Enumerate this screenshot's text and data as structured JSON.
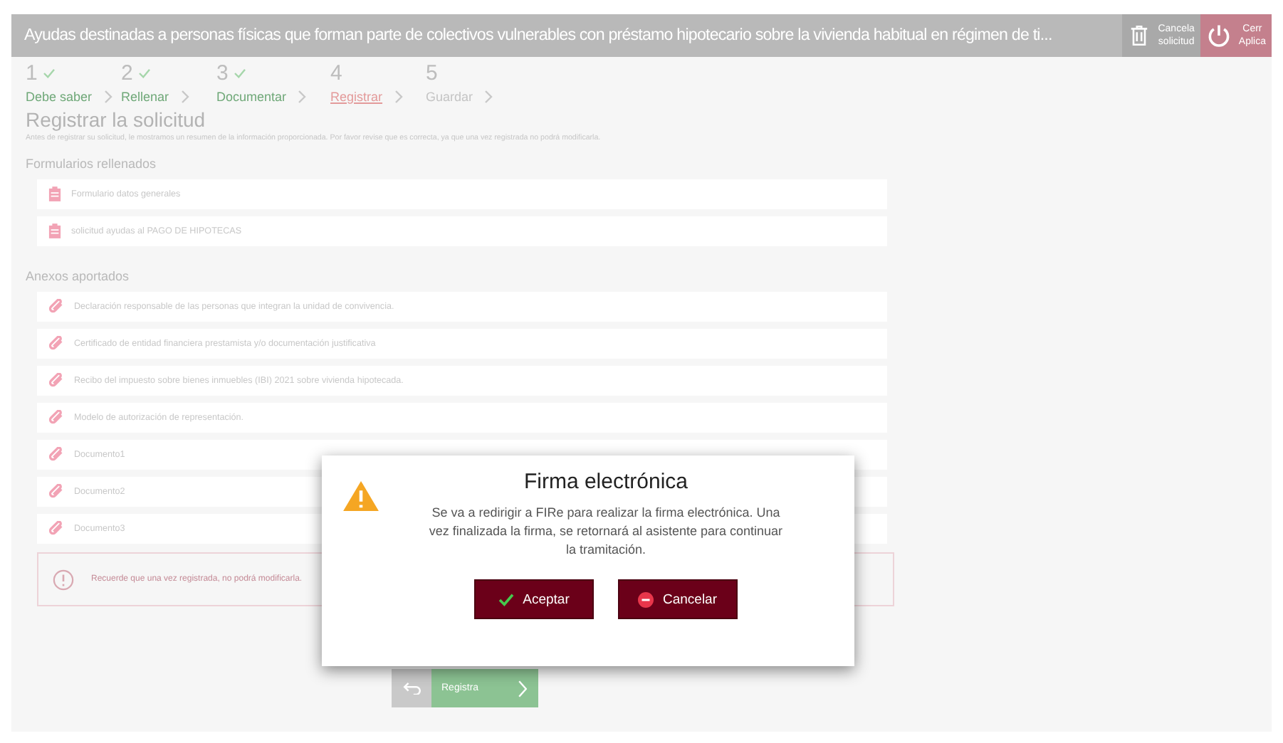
{
  "header": {
    "title": "Ayudas destinadas a personas físicas que forman parte de colectivos vulnerables con préstamo hipotecario sobre la vivienda habitual en régimen de ti...",
    "cancel_button": {
      "line_1": "Cancela",
      "line_2": "solicitud"
    },
    "close_button": {
      "line_1": "Cerr",
      "line_2": "Aplica"
    }
  },
  "steps": [
    {
      "number": "1",
      "label": "Debe saber",
      "done": true,
      "selected": false
    },
    {
      "number": "2",
      "label": "Rellenar",
      "done": true,
      "selected": false
    },
    {
      "number": "3",
      "label": "Documentar",
      "done": true,
      "selected": false
    },
    {
      "number": "4",
      "label": "Registrar",
      "done": false,
      "selected": true
    },
    {
      "number": "5",
      "label": "Guardar",
      "done": false,
      "selected": false
    }
  ],
  "heading": "Registrar la solicitud",
  "description": "Antes de registrar su solicitud, le mostramos un resumen de la información proporcionada. Por favor revise que es correcta, ya que una vez registrada no podrá modificarla.",
  "forms": {
    "title": "Formularios rellenados",
    "items": [
      "Formulario datos generales",
      "solicitud ayudas al PAGO DE HIPOTECAS"
    ]
  },
  "annexes": {
    "title": "Anexos aportados",
    "items": [
      "Declaración responsable de las personas que integran la unidad de convivencia.",
      "Certificado de entidad financiera prestamista y/o documentación justificativa",
      "Recibo del impuesto sobre bienes inmuebles (IBI) 2021 sobre vivienda hipotecada.",
      "Modelo de autorización de representación.",
      "Documento1",
      "Documento2",
      "Documento3"
    ]
  },
  "notice": "Recuerde que una vez registrada, no podrá modificarla.",
  "nav": {
    "next_label": "Registra"
  },
  "dialog": {
    "title": "Firma electrónica",
    "message": "Se va a redirigir a FIRe para realizar la firma electrónica. Una vez finalizada la firma, se retornará al asistente para continuar la tramitación.",
    "buttons": [
      {
        "label": "Aceptar",
        "kind": "accept"
      },
      {
        "label": "Cancelar",
        "kind": "cancel"
      }
    ]
  }
}
